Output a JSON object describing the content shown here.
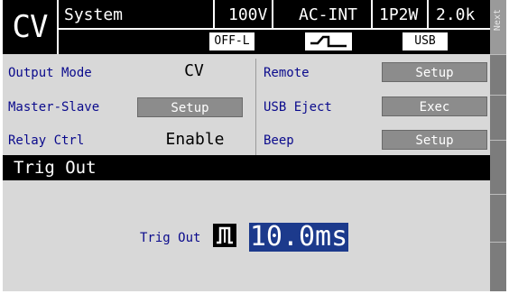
{
  "header": {
    "mode": "CV",
    "system_label": "System",
    "voltage_range": "100V",
    "input_source": "AC-INT",
    "phase": "1P2W",
    "power": "2.0k",
    "output_state": "OFF-L",
    "waveform_icon": "square-wave-icon",
    "interface": "USB"
  },
  "side": {
    "next_label": "Next"
  },
  "rows": {
    "output_mode": {
      "label": "Output Mode",
      "value": "CV"
    },
    "master_slave": {
      "label": "Master-Slave",
      "button": "Setup"
    },
    "relay_ctrl": {
      "label": "Relay Ctrl",
      "value": "Enable"
    },
    "remote": {
      "label": "Remote",
      "button": "Setup"
    },
    "usb_eject": {
      "label": "USB Eject",
      "button": "Exec"
    },
    "beep": {
      "label": "Beep",
      "button": "Setup"
    }
  },
  "trig_panel": {
    "title": "Trig Out",
    "label": "Trig Out",
    "icon": "pulse-icon",
    "value": "10.0ms"
  },
  "colors": {
    "label_blue": "#0a0a8c",
    "button_gray": "#8c8c8c",
    "highlight_blue": "#1c3a8c",
    "background": "#d8d8d8"
  }
}
